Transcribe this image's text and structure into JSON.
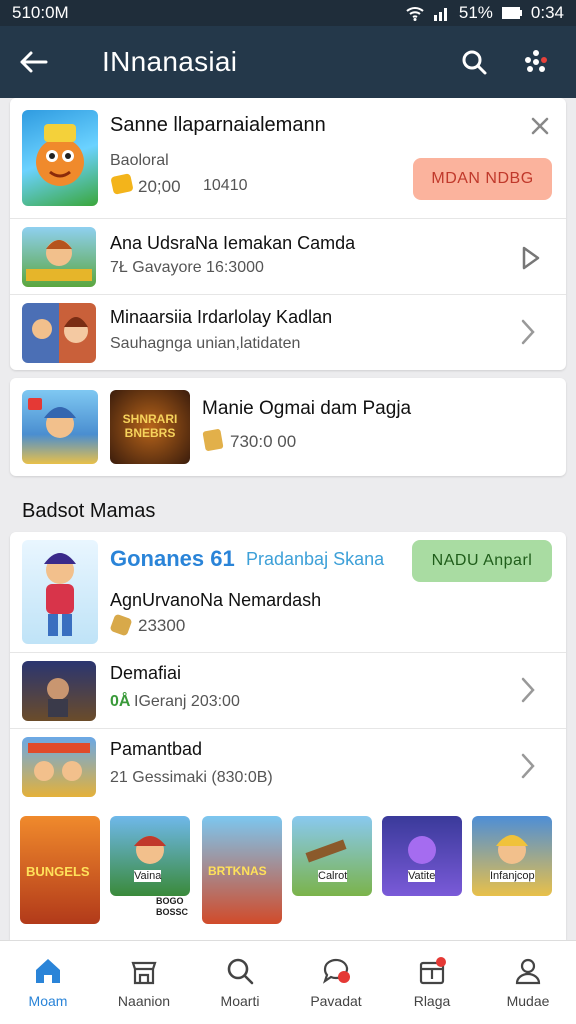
{
  "status": {
    "time_left": "510:0M",
    "battery": "51%",
    "time_right": "0:34"
  },
  "appbar": {
    "title": "INnanasiai"
  },
  "featured": {
    "title": "Sanne llaparnaialemann",
    "subtitle": "Baoloral",
    "price": "20;00",
    "extra": "10410",
    "button": "MDAN NDBG"
  },
  "list_top": [
    {
      "title": "Ana UdsraNa Iemakan Camda",
      "sub": "7Ł Gavayore 16:3000"
    },
    {
      "title": "Minaarsiia Irdarlolay Kadlan",
      "sub": "Sauhagnga unian,latidaten"
    }
  ],
  "promo": {
    "title": "Manie Ogmai dam Pagja",
    "price": "730:0 00",
    "banner_text": "SHNRARI BNEBRS"
  },
  "section": {
    "title": "Badsot Mamas"
  },
  "game_card": {
    "name": "Gonanes 61",
    "publisher": "Pradanbaj Skana",
    "button": "NADU Anparl",
    "subtitle": "AgnUrvanoNa Nemardash",
    "count": "23300"
  },
  "list_bottom": [
    {
      "title": "Demafiai",
      "sub": "IGeranj 203:00",
      "prefix": "0Å"
    },
    {
      "title": "Pamantbad",
      "sub": "21 Gessimaki (830:0B)"
    }
  ],
  "grid": [
    {
      "label": "BUNGELS"
    },
    {
      "label": "Vaina",
      "extra": "BOGO BOSSC"
    },
    {
      "label": "BRTKNAS"
    },
    {
      "label": "Calrot"
    },
    {
      "label": "Vatite"
    },
    {
      "label": "Infanjcop"
    }
  ],
  "nav": [
    {
      "label": "Moam"
    },
    {
      "label": "Naanion"
    },
    {
      "label": "Moarti"
    },
    {
      "label": "Pavadat"
    },
    {
      "label": "Rlaga"
    },
    {
      "label": "Mudae"
    }
  ],
  "colors": {
    "accent": "#2a84d8",
    "appbar": "#24384a",
    "orange_button": "#fbb39d",
    "green_button": "#a9dca2"
  }
}
